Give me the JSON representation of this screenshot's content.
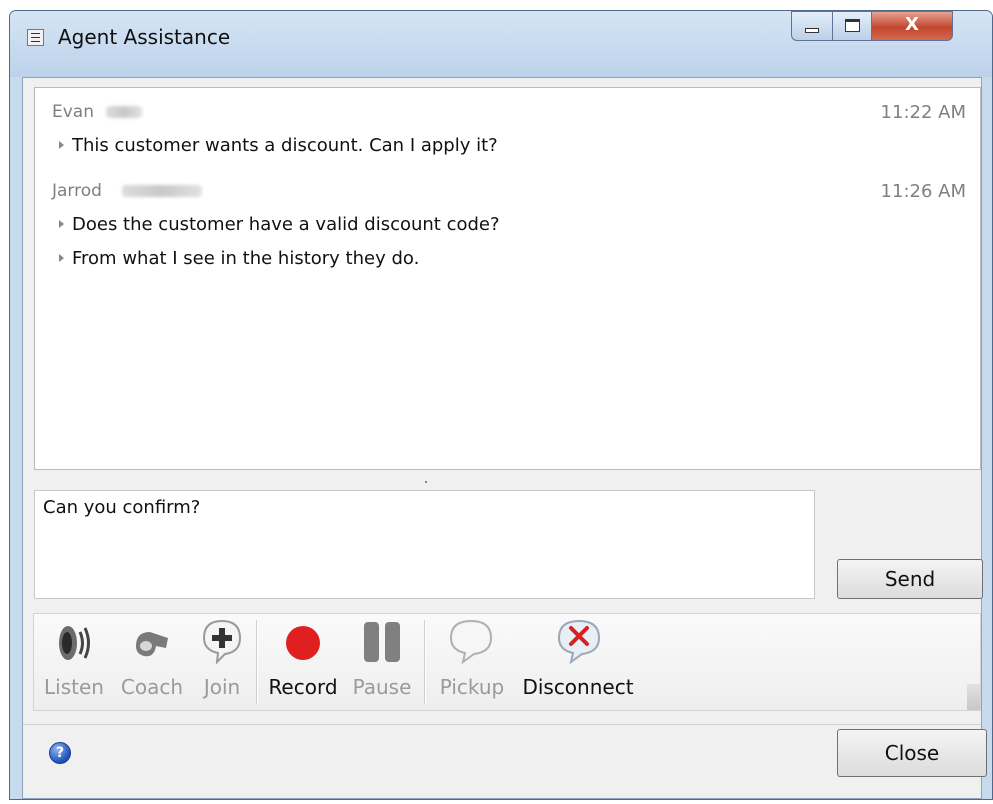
{
  "window": {
    "title": "Agent Assistance",
    "close_glyph": "X"
  },
  "history": {
    "groups": [
      {
        "sender": "Evan",
        "time": "11:22 AM",
        "messages": [
          "This customer wants a discount.  Can I apply it?"
        ]
      },
      {
        "sender": "Jarrod",
        "time": "11:26 AM",
        "messages": [
          "Does the customer have a valid discount code?",
          "From what I see in the history they do."
        ]
      }
    ]
  },
  "compose": {
    "value": "Can you confirm?"
  },
  "buttons": {
    "send": "Send",
    "close": "Close"
  },
  "toolbar": {
    "items": [
      {
        "label": "Listen",
        "icon": "speaker-icon",
        "enabled": false
      },
      {
        "label": "Coach",
        "icon": "whistle-icon",
        "enabled": false
      },
      {
        "label": "Join",
        "icon": "plus-bubble-icon",
        "enabled": false
      },
      {
        "label": "Record",
        "icon": "record-icon",
        "enabled": true
      },
      {
        "label": "Pause",
        "icon": "pause-icon",
        "enabled": false
      },
      {
        "label": "Pickup",
        "icon": "speech-bubble-icon",
        "enabled": false
      },
      {
        "label": "Disconnect",
        "icon": "disconnect-bubble-icon",
        "enabled": true
      }
    ]
  },
  "footer": {
    "help_glyph": "?"
  },
  "colors": {
    "record_red": "#e02020",
    "disconnect_red": "#d42222",
    "help_blue": "#1d4fb8"
  }
}
